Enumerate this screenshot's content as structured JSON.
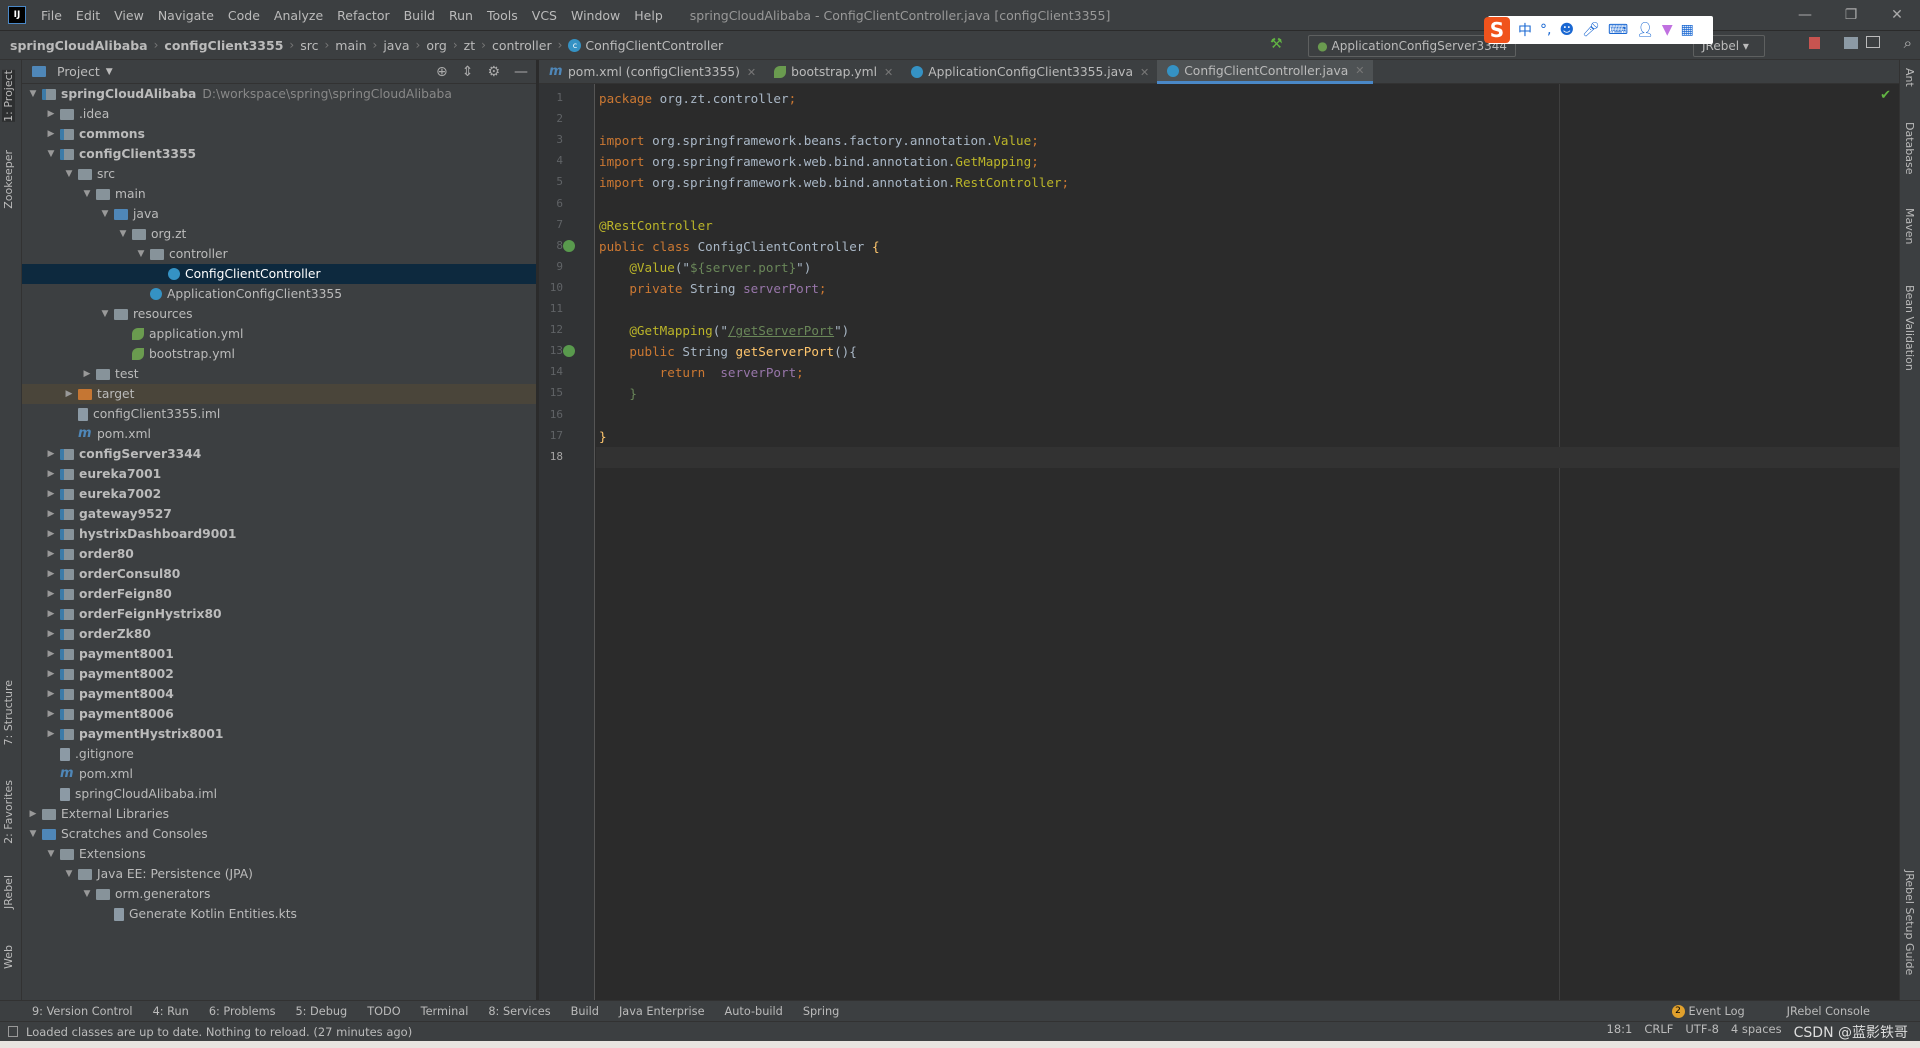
{
  "titlebar": {
    "menu": [
      "File",
      "Edit",
      "View",
      "Navigate",
      "Code",
      "Analyze",
      "Refactor",
      "Build",
      "Run",
      "Tools",
      "VCS",
      "Window",
      "Help"
    ],
    "title": "springCloudAlibaba - ConfigClientController.java [configClient3355]"
  },
  "breadcrumb": [
    "springCloudAlibaba",
    "configClient3355",
    "src",
    "main",
    "java",
    "org",
    "zt",
    "controller",
    "ConfigClientController"
  ],
  "toolbar": {
    "run_config": "ApplicationConfigServer3344",
    "jrebel": "JRebel"
  },
  "ime": {
    "items": [
      "中",
      "°,"
    ]
  },
  "project": {
    "title": "Project",
    "tree": [
      {
        "label": "springCloudAlibaba",
        "path": "D:\\workspace\\spring\\springCloudAlibaba",
        "level": 0,
        "exp": "open",
        "icon": "module",
        "bold": true
      },
      {
        "label": ".idea",
        "level": 1,
        "exp": "closed",
        "icon": "folder"
      },
      {
        "label": "commons",
        "level": 1,
        "exp": "closed",
        "icon": "module",
        "bold": true
      },
      {
        "label": "configClient3355",
        "level": 1,
        "exp": "open",
        "icon": "module",
        "bold": true
      },
      {
        "label": "src",
        "level": 2,
        "exp": "open",
        "icon": "folder"
      },
      {
        "label": "main",
        "level": 3,
        "exp": "open",
        "icon": "folder"
      },
      {
        "label": "java",
        "level": 4,
        "exp": "open",
        "icon": "src"
      },
      {
        "label": "org.zt",
        "level": 5,
        "exp": "open",
        "icon": "folder"
      },
      {
        "label": "controller",
        "level": 6,
        "exp": "open",
        "icon": "folder"
      },
      {
        "label": "ConfigClientController",
        "level": 7,
        "exp": "none",
        "icon": "cls",
        "selected": true
      },
      {
        "label": "ApplicationConfigClient3355",
        "level": 6,
        "exp": "none",
        "icon": "cls"
      },
      {
        "label": "resources",
        "level": 4,
        "exp": "open",
        "icon": "folder"
      },
      {
        "label": "application.yml",
        "level": 5,
        "exp": "none",
        "icon": "spring"
      },
      {
        "label": "bootstrap.yml",
        "level": 5,
        "exp": "none",
        "icon": "spring"
      },
      {
        "label": "test",
        "level": 3,
        "exp": "closed",
        "icon": "folder"
      },
      {
        "label": "target",
        "level": 2,
        "exp": "closed",
        "icon": "orange",
        "highlight": true
      },
      {
        "label": "configClient3355.iml",
        "level": 2,
        "exp": "none",
        "icon": "file"
      },
      {
        "label": "pom.xml",
        "level": 2,
        "exp": "none",
        "icon": "m"
      },
      {
        "label": "configServer3344",
        "level": 1,
        "exp": "closed",
        "icon": "module",
        "bold": true
      },
      {
        "label": "eureka7001",
        "level": 1,
        "exp": "closed",
        "icon": "module",
        "bold": true
      },
      {
        "label": "eureka7002",
        "level": 1,
        "exp": "closed",
        "icon": "module",
        "bold": true
      },
      {
        "label": "gateway9527",
        "level": 1,
        "exp": "closed",
        "icon": "module",
        "bold": true
      },
      {
        "label": "hystrixDashboard9001",
        "level": 1,
        "exp": "closed",
        "icon": "module",
        "bold": true
      },
      {
        "label": "order80",
        "level": 1,
        "exp": "closed",
        "icon": "module",
        "bold": true
      },
      {
        "label": "orderConsul80",
        "level": 1,
        "exp": "closed",
        "icon": "module",
        "bold": true
      },
      {
        "label": "orderFeign80",
        "level": 1,
        "exp": "closed",
        "icon": "module",
        "bold": true
      },
      {
        "label": "orderFeignHystrix80",
        "level": 1,
        "exp": "closed",
        "icon": "module",
        "bold": true
      },
      {
        "label": "orderZk80",
        "level": 1,
        "exp": "closed",
        "icon": "module",
        "bold": true
      },
      {
        "label": "payment8001",
        "level": 1,
        "exp": "closed",
        "icon": "module",
        "bold": true
      },
      {
        "label": "payment8002",
        "level": 1,
        "exp": "closed",
        "icon": "module",
        "bold": true
      },
      {
        "label": "payment8004",
        "level": 1,
        "exp": "closed",
        "icon": "module",
        "bold": true
      },
      {
        "label": "payment8006",
        "level": 1,
        "exp": "closed",
        "icon": "module",
        "bold": true
      },
      {
        "label": "paymentHystrix8001",
        "level": 1,
        "exp": "closed",
        "icon": "module",
        "bold": true
      },
      {
        "label": ".gitignore",
        "level": 1,
        "exp": "none",
        "icon": "file"
      },
      {
        "label": "pom.xml",
        "level": 1,
        "exp": "none",
        "icon": "m"
      },
      {
        "label": "springCloudAlibaba.iml",
        "level": 1,
        "exp": "none",
        "icon": "file"
      },
      {
        "label": "External Libraries",
        "level": 0,
        "exp": "closed",
        "icon": "folder"
      },
      {
        "label": "Scratches and Consoles",
        "level": 0,
        "exp": "open",
        "icon": "src"
      },
      {
        "label": "Extensions",
        "level": 1,
        "exp": "open",
        "icon": "folder"
      },
      {
        "label": "Java EE: Persistence (JPA)",
        "level": 2,
        "exp": "open",
        "icon": "folder"
      },
      {
        "label": "orm.generators",
        "level": 3,
        "exp": "open",
        "icon": "folder"
      },
      {
        "label": "Generate Kotlin Entities.kts",
        "level": 4,
        "exp": "none",
        "icon": "file"
      }
    ]
  },
  "tabs": [
    {
      "label": "pom.xml (configClient3355)",
      "icon": "m"
    },
    {
      "label": "bootstrap.yml",
      "icon": "spring"
    },
    {
      "label": "ApplicationConfigClient3355.java",
      "icon": "cls"
    },
    {
      "label": "ConfigClientController.java",
      "icon": "cls",
      "active": true
    }
  ],
  "editor": {
    "current_line": 18,
    "lines": [
      [
        [
          "kw",
          "package "
        ],
        [
          "",
          "org.zt.controller"
        ],
        [
          "kw",
          ";"
        ]
      ],
      [],
      [
        [
          "kw",
          "import "
        ],
        [
          "",
          "org.springframework.beans.factory.annotation."
        ],
        [
          "an",
          "Value"
        ],
        [
          "kw",
          ";"
        ]
      ],
      [
        [
          "kw",
          "import "
        ],
        [
          "",
          "org.springframework.web.bind.annotation."
        ],
        [
          "an",
          "GetMapping"
        ],
        [
          "kw",
          ";"
        ]
      ],
      [
        [
          "kw",
          "import "
        ],
        [
          "",
          "org.springframework.web.bind.annotation."
        ],
        [
          "an",
          "RestController"
        ],
        [
          "kw",
          ";"
        ]
      ],
      [],
      [
        [
          "an",
          "@RestController"
        ]
      ],
      [
        [
          "kw",
          "public class "
        ],
        [
          "",
          "ConfigClientController "
        ],
        [
          "fn",
          "{"
        ]
      ],
      [
        [
          "",
          "    "
        ],
        [
          "an",
          "@Value"
        ],
        [
          "",
          "(\""
        ],
        [
          "st",
          "${server.port}"
        ],
        [
          "",
          "\")"
        ]
      ],
      [
        [
          "",
          "    "
        ],
        [
          "kw",
          "private "
        ],
        [
          "",
          "String "
        ],
        [
          "fd",
          "serverPort"
        ],
        [
          "kw",
          ";"
        ]
      ],
      [],
      [
        [
          "",
          "    "
        ],
        [
          "an",
          "@GetMapping"
        ],
        [
          "",
          "(\""
        ],
        [
          "lk",
          "/getServerPort"
        ],
        [
          "",
          "\")"
        ]
      ],
      [
        [
          "",
          "    "
        ],
        [
          "kw",
          "public "
        ],
        [
          "",
          "String "
        ],
        [
          "fn",
          "getServerPort"
        ],
        [
          "",
          "(){"
        ]
      ],
      [
        [
          "",
          "        "
        ],
        [
          "kw",
          "return  "
        ],
        [
          "fd",
          "serverPort"
        ],
        [
          "kw",
          ";"
        ]
      ],
      [
        [
          "",
          "    "
        ],
        [
          "st",
          "}"
        ]
      ],
      [],
      [
        [
          "fn",
          "}"
        ]
      ],
      []
    ]
  },
  "left_stripe": [
    "1: Project",
    "Zookeeper",
    "7: Structure",
    "2: Favorites",
    "JRebel",
    "Web"
  ],
  "right_stripe": [
    "Ant",
    "Database",
    "Maven",
    "Bean Validation",
    "JRebel Setup Guide"
  ],
  "bottom_tools": [
    "9: Version Control",
    "4: Run",
    "6: Problems",
    "5: Debug",
    "TODO",
    "Terminal",
    "8: Services",
    "Build",
    "Java Enterprise",
    "Auto-build",
    "Spring"
  ],
  "bottom_right": [
    "Event Log",
    "JRebel Console"
  ],
  "event_count": "2",
  "status": {
    "message": "Loaded classes are up to date. Nothing to reload. (27 minutes ago)",
    "position": "18:1",
    "line_sep": "CRLF",
    "encoding": "UTF-8",
    "indent": "4 spaces",
    "watermark": "CSDN @蓝影铁哥"
  }
}
